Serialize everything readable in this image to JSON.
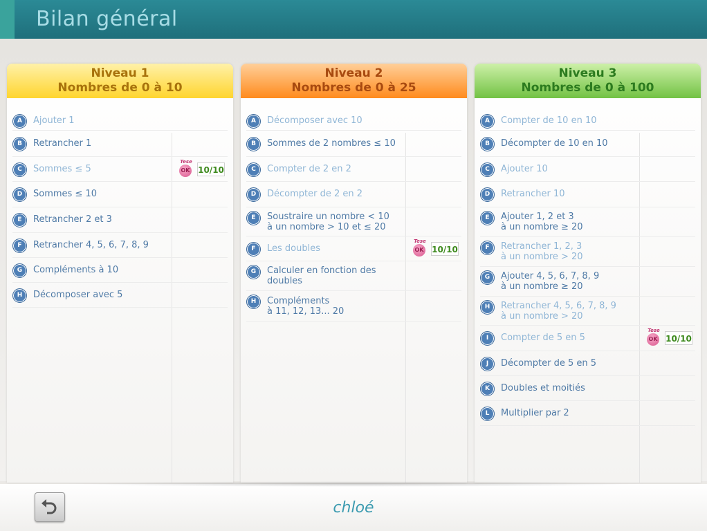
{
  "header": {
    "title": "Bilan général"
  },
  "user": {
    "name": "chloé"
  },
  "colors": {
    "level1": "#ffd52e",
    "level2": "#ff8b1d",
    "level3": "#72c244",
    "topbar": "#1f6f7b",
    "badge": "#4e7fb6",
    "score": "#3e8a1e"
  },
  "test_badge": {
    "top": "Tese",
    "ok": "OK"
  },
  "levels": [
    {
      "title": "Niveau 1",
      "subtitle": "Nombres de 0 à 10",
      "items": [
        {
          "letter": "A",
          "label": "Ajouter 1",
          "state": "light"
        },
        {
          "letter": "B",
          "label": "Retrancher 1",
          "state": "normal"
        },
        {
          "letter": "C",
          "label": "Sommes ≤ 5",
          "state": "light",
          "score": "10/10"
        },
        {
          "letter": "D",
          "label": "Sommes ≤ 10",
          "state": "normal"
        },
        {
          "letter": "E",
          "label": "Retrancher 2 et 3",
          "state": "normal"
        },
        {
          "letter": "F",
          "label": "Retrancher 4, 5, 6, 7, 8, 9",
          "state": "normal"
        },
        {
          "letter": "G",
          "label": "Compléments à 10",
          "state": "normal"
        },
        {
          "letter": "H",
          "label": "Décomposer avec 5",
          "state": "normal"
        }
      ]
    },
    {
      "title": "Niveau 2",
      "subtitle": "Nombres de 0 à 25",
      "items": [
        {
          "letter": "A",
          "label": "Décomposer avec 10",
          "state": "light"
        },
        {
          "letter": "B",
          "label": "Sommes de 2 nombres ≤ 10",
          "state": "normal"
        },
        {
          "letter": "C",
          "label": "Compter de 2 en 2",
          "state": "light"
        },
        {
          "letter": "D",
          "label": "Décompter de 2 en 2",
          "state": "light"
        },
        {
          "letter": "E",
          "label": "Soustraire un nombre < 10\nà un nombre > 10 et ≤ 20",
          "state": "normal"
        },
        {
          "letter": "F",
          "label": "Les doubles",
          "state": "light",
          "score": "10/10"
        },
        {
          "letter": "G",
          "label": "Calculer en fonction des\ndoubles",
          "state": "normal"
        },
        {
          "letter": "H",
          "label": "Compléments\nà  11,  12,  13...  20",
          "state": "normal"
        }
      ]
    },
    {
      "title": "Niveau 3",
      "subtitle": "Nombres de 0 à 100",
      "items": [
        {
          "letter": "A",
          "label": "Compter de 10 en 10",
          "state": "light"
        },
        {
          "letter": "B",
          "label": "Décompter de 10 en 10",
          "state": "normal"
        },
        {
          "letter": "C",
          "label": "Ajouter 10",
          "state": "light"
        },
        {
          "letter": "D",
          "label": "Retrancher 10",
          "state": "light"
        },
        {
          "letter": "E",
          "label": "Ajouter 1, 2 et 3\nà  un  nombre  ≥  20",
          "state": "normal"
        },
        {
          "letter": "F",
          "label": "Retrancher 1, 2, 3\nà  un  nombre  >  20",
          "state": "light"
        },
        {
          "letter": "G",
          "label": "Ajouter 4, 5, 6, 7, 8, 9\nà  un  nombre  ≥  20",
          "state": "normal"
        },
        {
          "letter": "H",
          "label": "Retrancher 4, 5, 6, 7, 8, 9\nà  un  nombre  >  20",
          "state": "light"
        },
        {
          "letter": "I",
          "label": "Compter de 5 en 5",
          "state": "light",
          "score": "10/10"
        },
        {
          "letter": "J",
          "label": "Décompter de 5 en 5",
          "state": "normal"
        },
        {
          "letter": "K",
          "label": "Doubles et moitiés",
          "state": "normal"
        },
        {
          "letter": "L",
          "label": "Multiplier par 2",
          "state": "normal"
        }
      ]
    }
  ]
}
